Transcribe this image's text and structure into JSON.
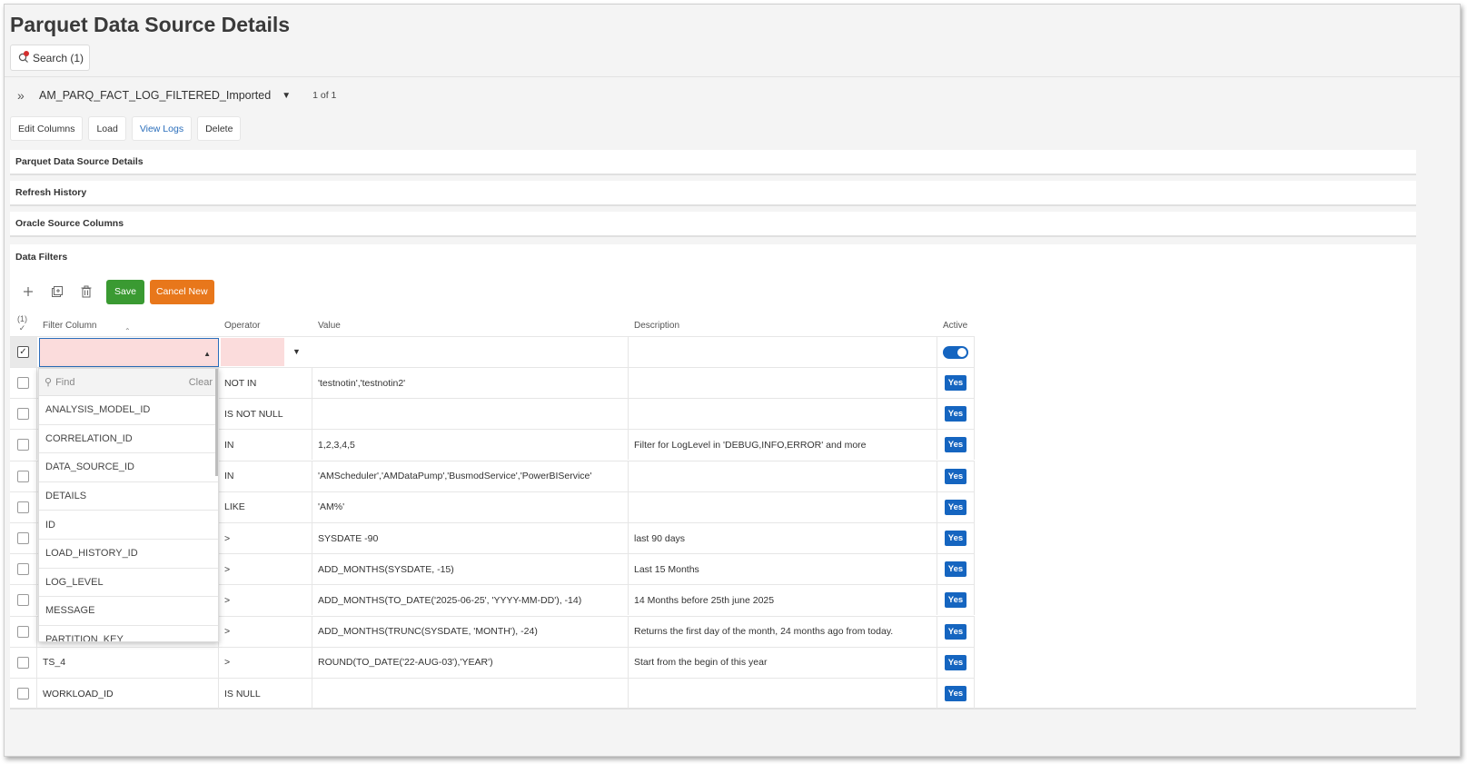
{
  "page": {
    "title": "Parquet Data Source Details",
    "search_label": "Search (1)"
  },
  "record": {
    "name": "AM_PARQ_FACT_LOG_FILTERED_Imported",
    "count": "1 of 1"
  },
  "actions": {
    "edit_columns": "Edit Columns",
    "load": "Load",
    "view_logs": "View Logs",
    "delete": "Delete"
  },
  "sections": {
    "details": "Parquet Data Source Details",
    "refresh_history": "Refresh History",
    "oracle_columns": "Oracle Source Columns",
    "data_filters": "Data Filters"
  },
  "toolbar": {
    "save": "Save",
    "cancel_new": "Cancel New"
  },
  "grid": {
    "selected_count": "(1)",
    "headers": {
      "filter_column": "Filter Column",
      "operator": "Operator",
      "value": "Value",
      "description": "Description",
      "active": "Active"
    },
    "rows": [
      {
        "column": "",
        "operator": "NOT IN",
        "value": "'testnotin','testnotin2'",
        "description": "",
        "active": "Yes"
      },
      {
        "column": "",
        "operator": "IS NOT NULL",
        "value": "",
        "description": "",
        "active": "Yes"
      },
      {
        "column": "",
        "operator": "IN",
        "value": "1,2,3,4,5",
        "description": "Filter for LogLevel in 'DEBUG,INFO,ERROR' and more",
        "active": "Yes"
      },
      {
        "column": "",
        "operator": "IN",
        "value": "'AMScheduler','AMDataPump','BusmodService','PowerBIService'",
        "description": "",
        "active": "Yes"
      },
      {
        "column": "",
        "operator": "LIKE",
        "value": "'AM%'",
        "description": "",
        "active": "Yes"
      },
      {
        "column": "",
        "operator": ">",
        "value": "SYSDATE -90",
        "description": "last 90 days",
        "active": "Yes"
      },
      {
        "column": "",
        "operator": ">",
        "value": "ADD_MONTHS(SYSDATE, -15)",
        "description": "Last 15 Months",
        "active": "Yes"
      },
      {
        "column": "",
        "operator": ">",
        "value": "ADD_MONTHS(TO_DATE('2025-06-25', 'YYYY-MM-DD'), -14)",
        "description": "14 Months before 25th june 2025",
        "active": "Yes"
      },
      {
        "column": "",
        "operator": ">",
        "value": "ADD_MONTHS(TRUNC(SYSDATE, 'MONTH'), -24)",
        "description": "Returns the first day of the month, 24 months ago from today.",
        "active": "Yes"
      },
      {
        "column": "TS_4",
        "operator": ">",
        "value": "ROUND(TO_DATE('22-AUG-03'),'YEAR')",
        "description": "Start from the begin of this year",
        "active": "Yes"
      },
      {
        "column": "WORKLOAD_ID",
        "operator": "IS NULL",
        "value": "",
        "description": "",
        "active": "Yes"
      }
    ]
  },
  "dropdown": {
    "find_placeholder": "Find",
    "clear_label": "Clear",
    "options": [
      "ANALYSIS_MODEL_ID",
      "CORRELATION_ID",
      "DATA_SOURCE_ID",
      "DETAILS",
      "ID",
      "LOAD_HISTORY_ID",
      "LOG_LEVEL",
      "MESSAGE",
      "PARTITION_KEY"
    ]
  },
  "colors": {
    "save": "#3a9a32",
    "cancel": "#e8771b",
    "yes_badge": "#1565c0",
    "required_field": "#fbdcdc"
  }
}
